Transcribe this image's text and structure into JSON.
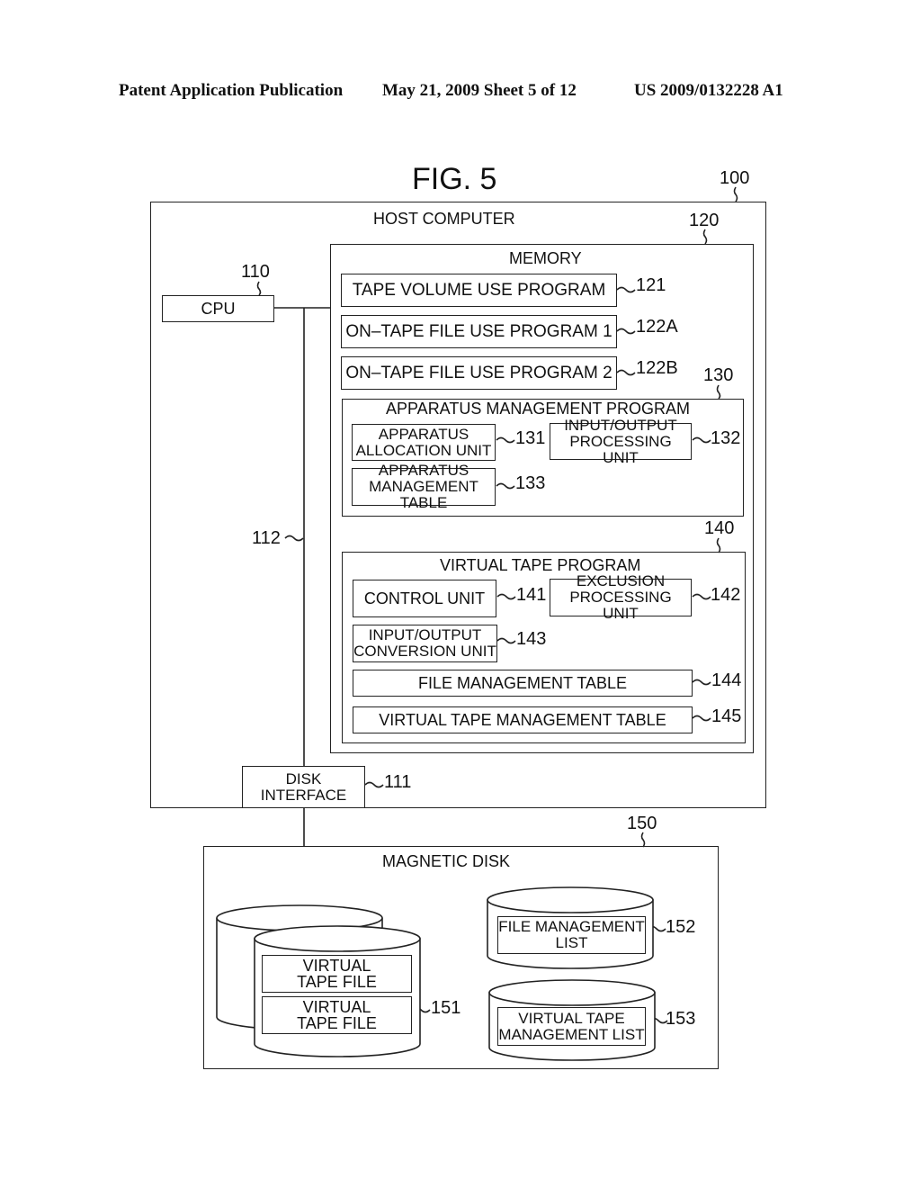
{
  "header": {
    "publication": "Patent Application Publication",
    "date_sheet": "May 21, 2009  Sheet 5 of 12",
    "pub_number": "US 2009/0132228 A1"
  },
  "figure": {
    "title": "FIG. 5"
  },
  "host_computer": {
    "label": "HOST COMPUTER",
    "ref": "100",
    "cpu": {
      "label": "CPU",
      "ref": "110"
    },
    "bus": {
      "ref": "112"
    },
    "disk_interface": {
      "line1": "DISK",
      "line2": "INTERFACE",
      "ref": "111"
    },
    "memory": {
      "label": "MEMORY",
      "ref": "120",
      "programs": [
        {
          "label": "TAPE VOLUME USE PROGRAM",
          "ref": "121"
        },
        {
          "label": "ON–TAPE FILE USE PROGRAM 1",
          "ref": "122A"
        },
        {
          "label": "ON–TAPE FILE USE PROGRAM 2",
          "ref": "122B"
        }
      ],
      "apparatus_management_program": {
        "label": "APPARATUS MANAGEMENT PROGRAM",
        "ref": "130",
        "units": [
          {
            "line1": "APPARATUS",
            "line2": "ALLOCATION UNIT",
            "ref": "131"
          },
          {
            "line1": "INPUT/OUTPUT",
            "line2": "PROCESSING UNIT",
            "ref": "132"
          },
          {
            "line1": "APPARATUS",
            "line2": "MANAGEMENT TABLE",
            "ref": "133"
          }
        ]
      },
      "virtual_tape_program": {
        "label": "VIRTUAL TAPE PROGRAM",
        "ref": "140",
        "units": [
          {
            "line1": "CONTROL UNIT",
            "ref": "141"
          },
          {
            "line1": "EXCLUSION",
            "line2": "PROCESSING UNIT",
            "ref": "142"
          },
          {
            "line1": "INPUT/OUTPUT",
            "line2": "CONVERSION UNIT",
            "ref": "143"
          },
          {
            "line1": "FILE MANAGEMENT TABLE",
            "ref": "144"
          },
          {
            "line1": "VIRTUAL TAPE MANAGEMENT TABLE",
            "ref": "145"
          }
        ]
      }
    }
  },
  "magnetic_disk": {
    "label": "MAGNETIC DISK",
    "ref": "150",
    "virtual_tape_files": {
      "ref": "151",
      "files": [
        {
          "line1": "VIRTUAL",
          "line2": "TAPE FILE"
        },
        {
          "line1": "VIRTUAL",
          "line2": "TAPE FILE"
        }
      ]
    },
    "file_management_list": {
      "line1": "FILE MANAGEMENT",
      "line2": "LIST",
      "ref": "152"
    },
    "virtual_tape_management_list": {
      "line1": "VIRTUAL TAPE",
      "line2": "MANAGEMENT LIST",
      "ref": "153"
    }
  }
}
